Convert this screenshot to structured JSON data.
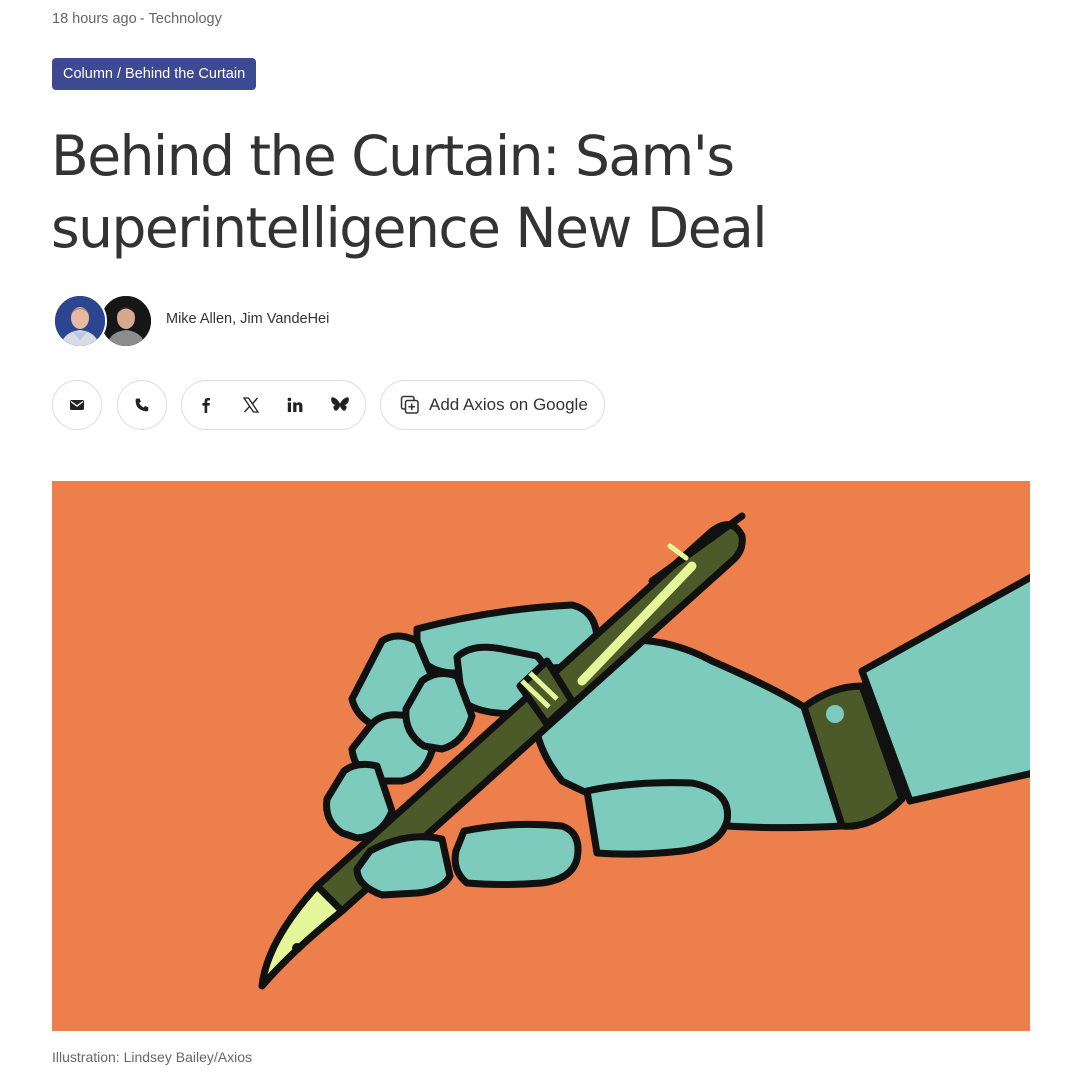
{
  "meta": {
    "time_ago": "18 hours ago",
    "separator": "-",
    "category": "Technology"
  },
  "tag": {
    "label": "Column / Behind the Curtain"
  },
  "headline": {
    "line1": "Behind the Curtain: Sam's",
    "line2": "superintelligence New Deal"
  },
  "byline": {
    "authors": "Mike Allen, Jim VandeHei"
  },
  "share": {
    "icons": [
      "email-icon",
      "phone-icon",
      "facebook-icon",
      "x-icon",
      "linkedin-icon",
      "bluesky-icon"
    ],
    "google_label": "Add Axios on Google"
  },
  "image": {
    "caption": "Illustration: Lindsey Bailey/Axios"
  },
  "colors": {
    "tag_bg": "#3d4a91",
    "hero_bg": "#ec7f4c",
    "robot_hand": "#7ccbbd",
    "pen_body": "#4c5a2a",
    "pen_highlight": "#e4f59a"
  }
}
